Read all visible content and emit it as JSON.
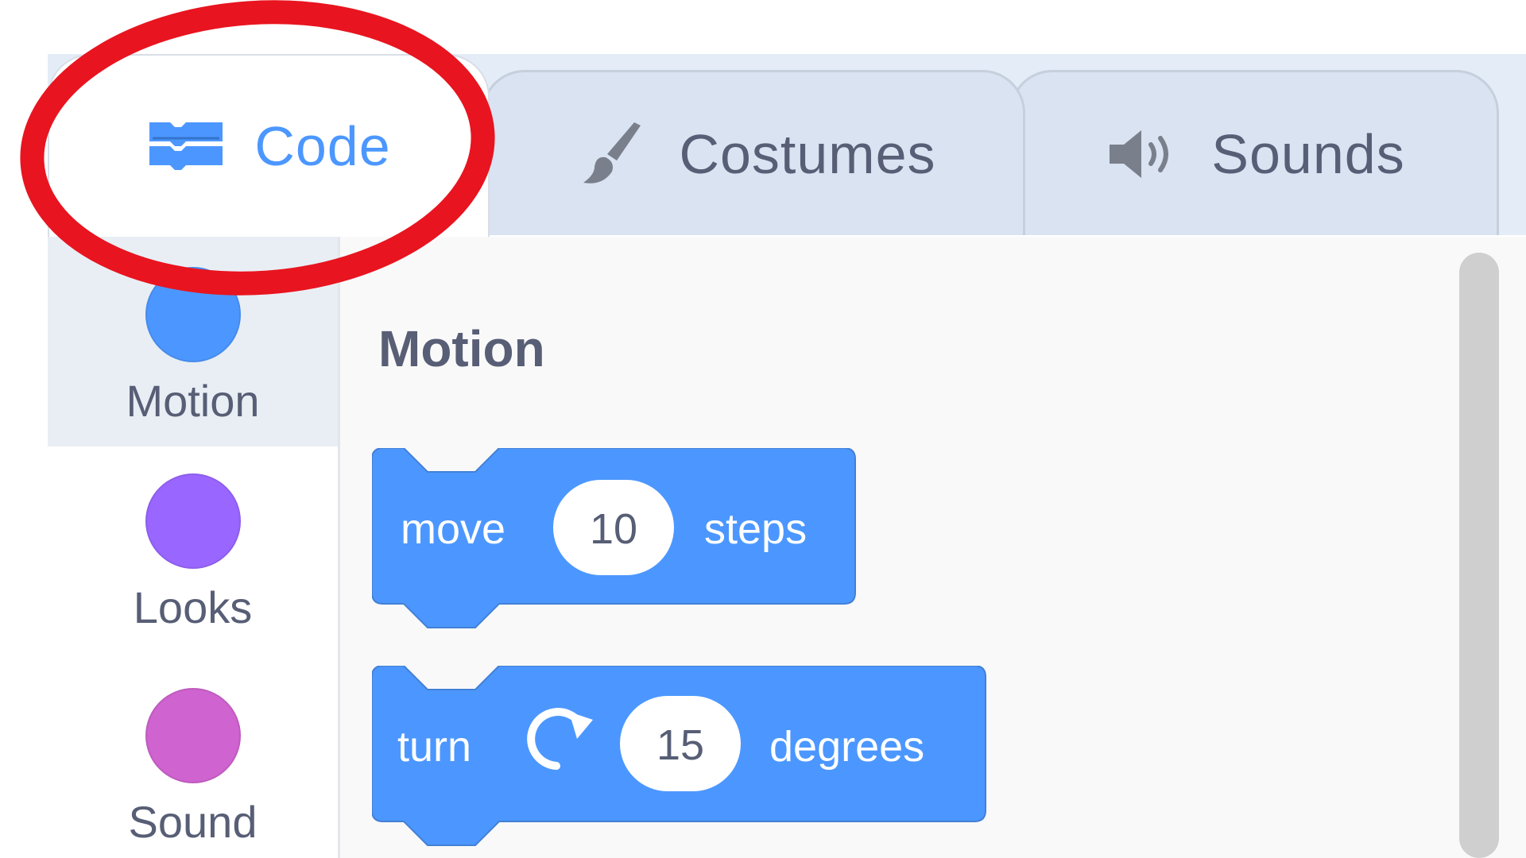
{
  "tabs": {
    "code": {
      "label": "Code",
      "icon": "code-blocks-icon"
    },
    "costumes": {
      "label": "Costumes",
      "icon": "paintbrush-icon"
    },
    "sounds": {
      "label": "Sounds",
      "icon": "speaker-icon"
    }
  },
  "categories": [
    {
      "label": "Motion",
      "color": "#4c97ff",
      "selected": true
    },
    {
      "label": "Looks",
      "color": "#9966ff",
      "selected": false
    },
    {
      "label": "Sound",
      "color": "#cf63cf",
      "selected": false
    }
  ],
  "palette": {
    "title": "Motion",
    "blocks": [
      {
        "pre": "move",
        "value": "10",
        "post": "steps"
      },
      {
        "pre": "turn",
        "icon": "rotate-clockwise-icon",
        "value": "15",
        "post": "degrees"
      }
    ]
  },
  "colors": {
    "accent": "#4c97ff",
    "annotation": "#e8141f",
    "text": "#575e75"
  }
}
